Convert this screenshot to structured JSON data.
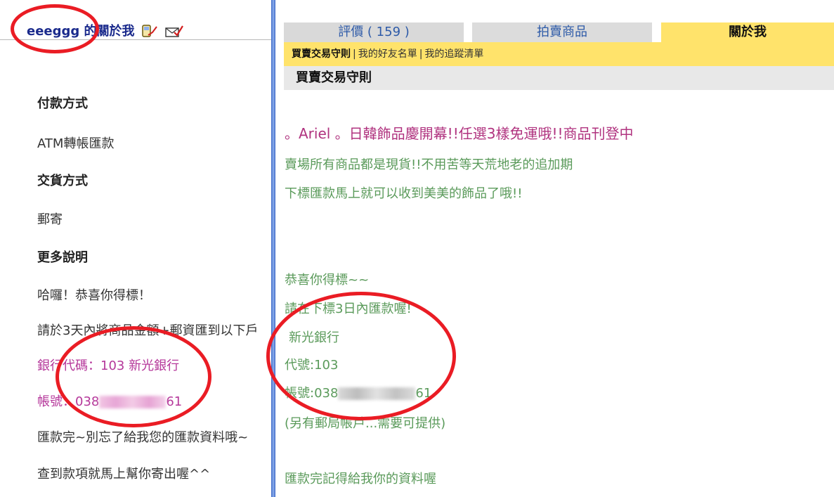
{
  "left": {
    "username": "eeeggg",
    "title_suffix": " 的關於我",
    "icons": [
      "phone-edit-icon",
      "mail-check-icon"
    ],
    "payment_heading": "付款方式",
    "payment_value": "ATM轉帳匯款",
    "delivery_heading": "交貨方式",
    "delivery_value": "郵寄",
    "more_heading": "更多說明",
    "lines": {
      "congrats": "哈囉！恭喜你得標！",
      "instruction": "請於3天內將商品金額+郵資匯到以下戶",
      "bank_code": "銀行代碼：103 新光銀行",
      "account_prefix": "帳號：038",
      "account_suffix": "61",
      "reminder": "匯款完~別忘了給我您的匯款資料哦~",
      "ship": "查到款項就馬上幫你寄出喔^^"
    }
  },
  "right": {
    "tabs": {
      "reviews": "評價 ( 159 )",
      "auction": "拍賣商品",
      "about": "關於我"
    },
    "subnav": {
      "rules": "買賣交易守則",
      "friends": "我的好友名單",
      "watchlist": "我的追蹤清單"
    },
    "section_title": "買賣交易守則",
    "promo": "。Ariel 。日韓飾品慶開幕!!任選3樣免運哦!!商品刊登中",
    "line1": "賣場所有商品都是現貨!!不用苦等天荒地老的追加期",
    "line2": "下標匯款馬上就可以收到美美的飾品了哦!!",
    "congrats": "恭喜你得標~~",
    "instruction": "請在下標3日內匯款喔!",
    "bank": "新光銀行",
    "code": "代號:103",
    "account_prefix": "帳號:038",
    "account_suffix": "61",
    "post_note": "(另有郵局帳戶...需要可提供)",
    "final": "匯款完記得給我你的資料喔"
  },
  "colors": {
    "tab_active": "#ffe36b",
    "tab_inactive": "#d9d9d9",
    "link_blue": "#2d5aa8",
    "pink_text": "#b5379a",
    "green_text": "#5a9a5a",
    "annotation_red": "#ea1c24"
  }
}
